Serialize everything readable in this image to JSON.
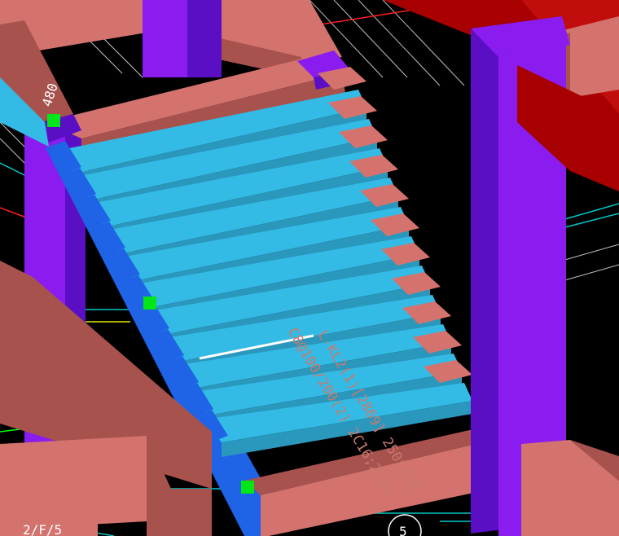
{
  "viewport": {
    "background": "#000000",
    "colors": {
      "stair_top": "#33bbe6",
      "stair_riser": "#2a97bc",
      "stair_side": "#1f63e6",
      "beam_top": "#d4736d",
      "beam_side": "#a8524e",
      "column_front": "#8a1cf0",
      "column_side": "#5a0fc4",
      "red_beam": "#a80000",
      "grip": "#00e619",
      "annotation_text": "#c87a6e",
      "annotation_line": "#ffffff",
      "grid_line": "#ffffff",
      "axis_line": "#00c8c8",
      "axis_line_red": "#ff2020"
    }
  },
  "annotation": {
    "line1": "L-KL2(1)[2869] 250*400",
    "line2": "C8@100/200(2) 2C16;2C16"
  },
  "labels": {
    "dimension_top_left": "480",
    "axis_bottom_left": "2/F/5",
    "axis_bottom_center": "5"
  },
  "grips": [
    {
      "name": "grip-top-left"
    },
    {
      "name": "grip-middle-left"
    },
    {
      "name": "grip-bottom"
    }
  ]
}
